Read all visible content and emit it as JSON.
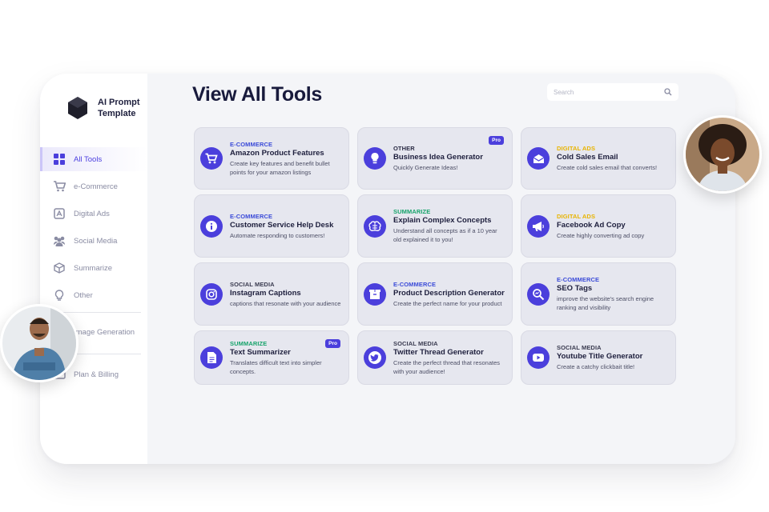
{
  "brand": {
    "name": "AI Prompt Template"
  },
  "sidebar": {
    "items": [
      {
        "label": "All Tools",
        "icon": "grid-icon",
        "active": true
      },
      {
        "label": "e-Commerce",
        "icon": "cart-icon"
      },
      {
        "label": "Digital Ads",
        "icon": "ad-icon"
      },
      {
        "label": "Social Media",
        "icon": "people-icon"
      },
      {
        "label": "Summarize",
        "icon": "cube-icon"
      },
      {
        "label": "Other",
        "icon": "bulb-icon"
      },
      {
        "label": "Image Generation",
        "icon": "image-icon"
      },
      {
        "label": "Plan & Billing",
        "icon": "card-icon"
      }
    ]
  },
  "page": {
    "title": "View All Tools"
  },
  "search": {
    "placeholder": "Search"
  },
  "categoryColors": {
    "E-COMMERCE": "#3b4bd8",
    "OTHER": "#2b2c45",
    "DIGITAL ADS": "#e8b400",
    "SUMMARIZE": "#17a36b",
    "SOCIAL MEDIA": "#3a3b50"
  },
  "cards": [
    {
      "category": "E-COMMERCE",
      "title": "Amazon Product Features",
      "desc": "Create key features and benefit bullet points for your amazon listings",
      "icon": "cart-icon",
      "pro": ""
    },
    {
      "category": "OTHER",
      "title": "Business Idea Generator",
      "desc": "Quickly Generate Ideas!",
      "icon": "bulb-icon",
      "pro": "Pro"
    },
    {
      "category": "DIGITAL ADS",
      "title": "Cold Sales Email",
      "desc": "Create cold sales email that converts!",
      "icon": "mail-icon",
      "pro": ""
    },
    {
      "category": "E-COMMERCE",
      "title": "Customer Service Help Desk",
      "desc": "Automate responding to customers!",
      "icon": "info-icon",
      "pro": ""
    },
    {
      "category": "SUMMARIZE",
      "title": "Explain Complex Concepts",
      "desc": "Understand all concepts as if a 10 year old explained it to you!",
      "icon": "brain-icon",
      "pro": ""
    },
    {
      "category": "DIGITAL ADS",
      "title": "Facebook Ad Copy",
      "desc": "Create highly converting ad copy",
      "icon": "megaphone-icon",
      "pro": ""
    },
    {
      "category": "SOCIAL MEDIA",
      "title": "Instagram Captions",
      "desc": "captions that resonate with your audience",
      "icon": "instagram-icon",
      "pro": ""
    },
    {
      "category": "E-COMMERCE",
      "title": "Product Description Generator",
      "desc": "Create the perfect name for your product",
      "icon": "box-icon",
      "pro": ""
    },
    {
      "category": "E-COMMERCE",
      "title": "SEO Tags",
      "desc": "improve the website's search engine ranking and visibility",
      "icon": "seo-icon",
      "pro": ""
    },
    {
      "category": "SUMMARIZE",
      "title": "Text Summarizer",
      "desc": "Translates difficult text into simpler concepts.",
      "icon": "document-icon",
      "pro": "Pro"
    },
    {
      "category": "SOCIAL MEDIA",
      "title": "Twitter Thread Generator",
      "desc": "Create the perfect thread that resonates with your audience!",
      "icon": "twitter-icon",
      "pro": ""
    },
    {
      "category": "SOCIAL MEDIA",
      "title": "Youtube Title Generator",
      "desc": "Create a catchy clickbait title!",
      "icon": "youtube-icon",
      "pro": ""
    }
  ]
}
